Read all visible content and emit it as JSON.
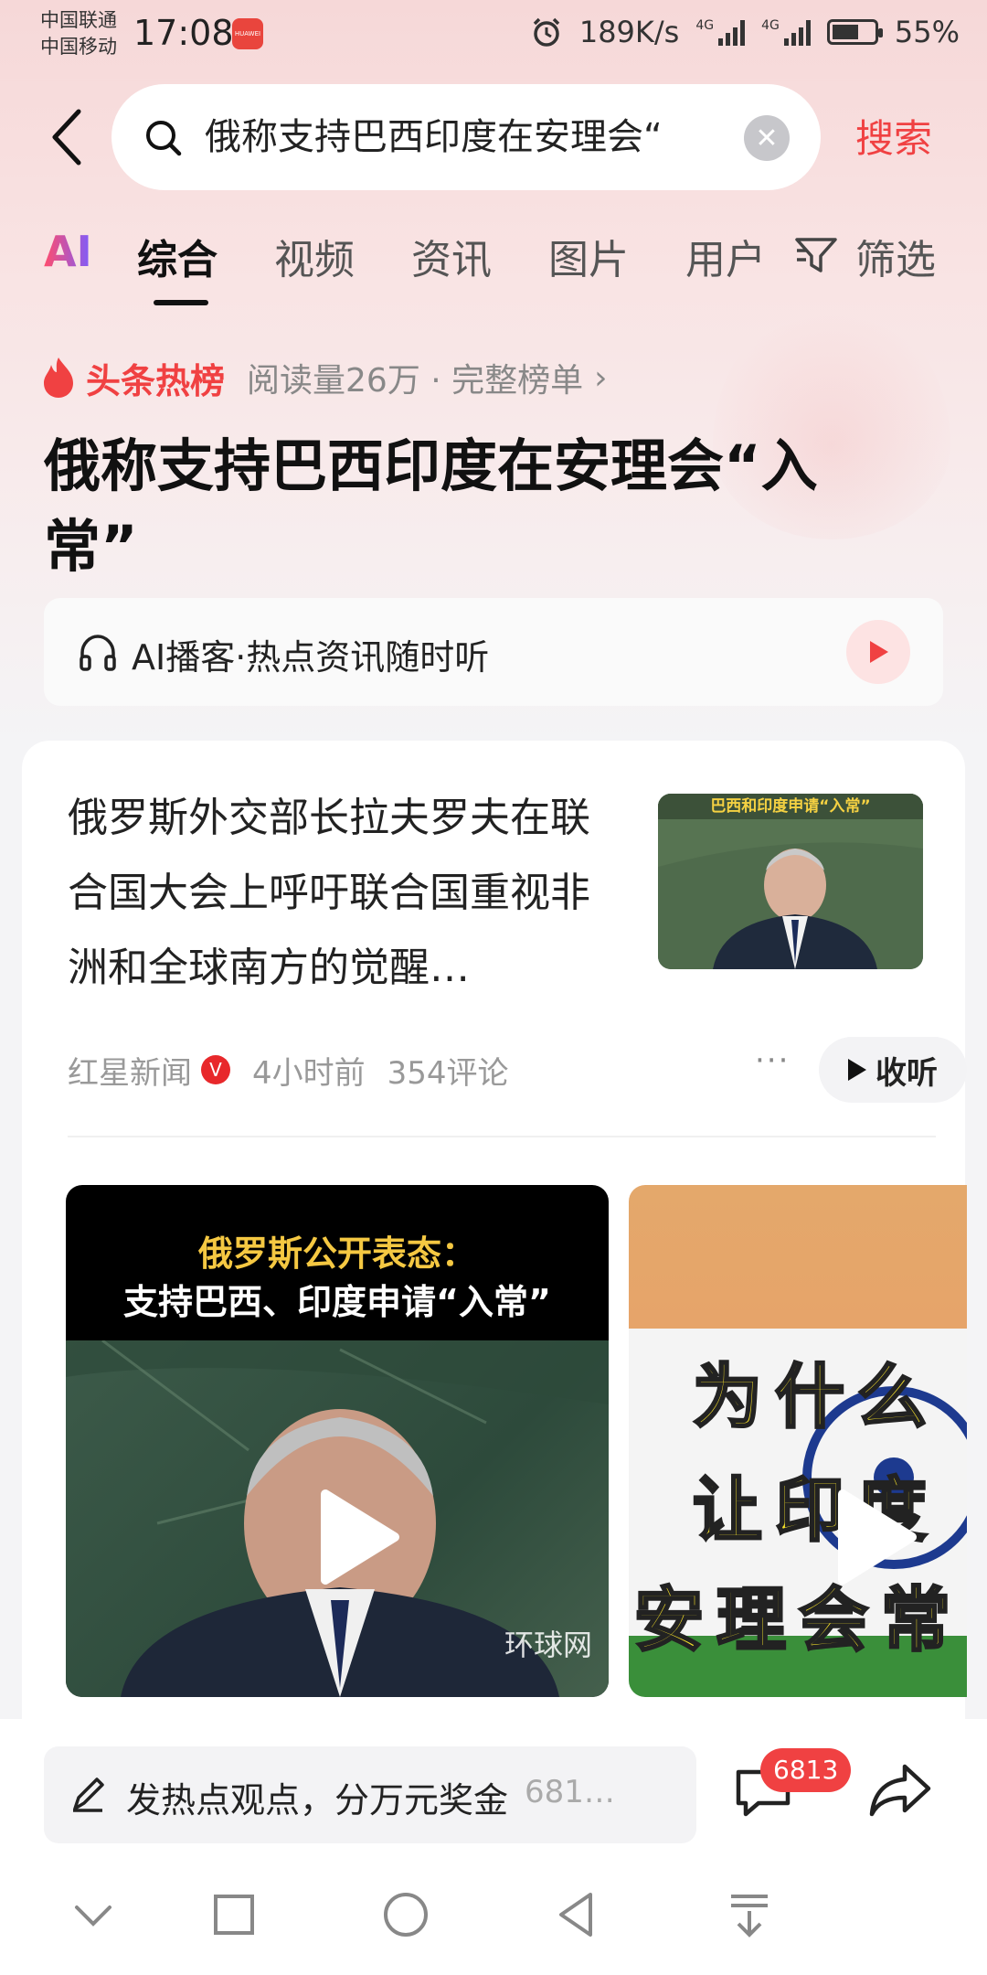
{
  "status_bar": {
    "carrier_1": "中国联通",
    "carrier_2": "中国移动",
    "time": "17:08",
    "app_badge": "HUAWEI",
    "net_speed": "189K/s",
    "net_type_1": "4G",
    "net_type_2": "4G",
    "battery": "55%"
  },
  "search": {
    "query": "俄称支持巴西印度在安理会“",
    "button": "搜索"
  },
  "tabs": {
    "ai": "AI",
    "items": [
      "综合",
      "视频",
      "资讯",
      "图片",
      "用户"
    ],
    "filter": "筛选"
  },
  "hot": {
    "label": "头条热榜",
    "meta": "阅读量26万 · 完整榜单",
    "title": "俄称支持巴西印度在安理会“入常”"
  },
  "podcast": {
    "text": "AI播客·热点资讯随时听"
  },
  "article": {
    "title": "俄罗斯外交部长拉夫罗夫在联合国大会上呼吁联合国重视非洲和全球南方的觉醒…",
    "thumb_caption": "巴西和印度申请“入常”",
    "source": "红星新闻",
    "verified": "V",
    "time": "4小时前",
    "comments": "354评论",
    "listen": "收听"
  },
  "video1": {
    "caption_1": "俄罗斯公开表态：",
    "caption_2": "支持巴西、印度申请“入常”",
    "watermark": "环球网"
  },
  "video2": {
    "line_1": "为什么",
    "line_2": "让印度",
    "line_3": "安理会常"
  },
  "bottom": {
    "comment_prompt": "发热点观点，分万元奖金",
    "comment_count": "681…",
    "badge": "6813"
  },
  "colors": {
    "accent": "#f04142"
  }
}
